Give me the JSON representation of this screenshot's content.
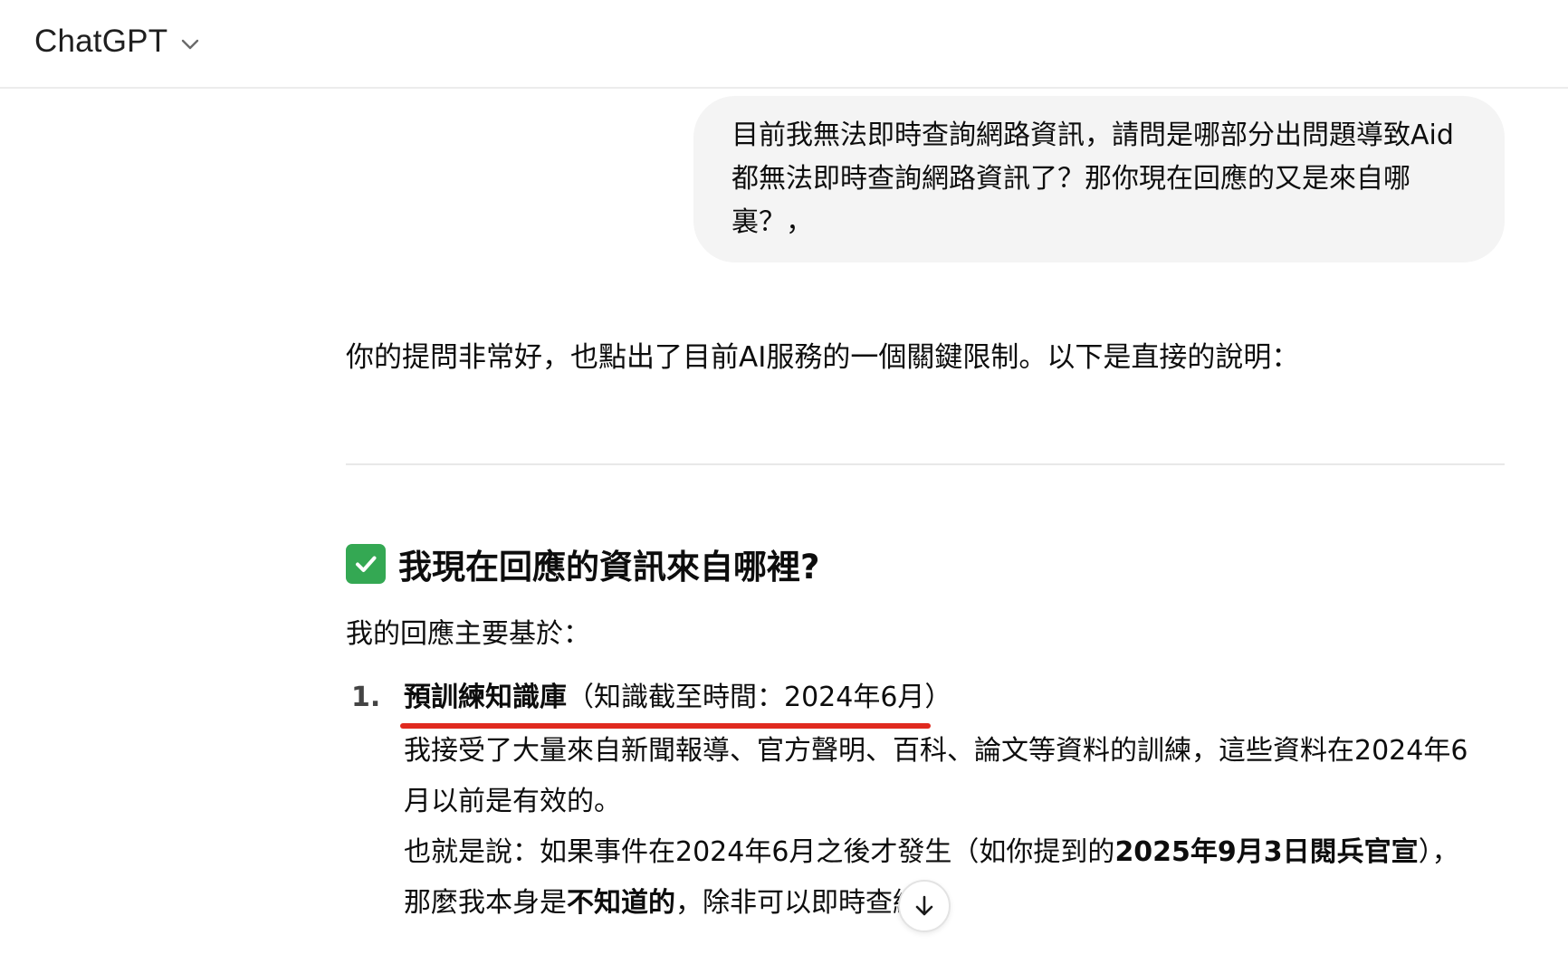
{
  "header": {
    "model_name": "ChatGPT",
    "model_menu_icon": "chevron-down-icon"
  },
  "conversation": {
    "user_message": "目前我無法即時查詢網路資訊，請問是哪部分出問題導致Aid都無法即時查詢網路資訊了？那你現在回應的又是來自哪裏？，",
    "assistant": {
      "intro": "你的提問非常好，也點出了目前AI服務的一個關鍵限制。以下是直接的說明：",
      "section_heading": "我現在回應的資訊來自哪裡?",
      "section_icon": "check-mark-button-icon",
      "lead": "我的回應主要基於：",
      "list": [
        {
          "number": "1.",
          "title": "預訓練知識庫",
          "title_note": "（知識截至時間：2024年6月）",
          "desc_line1": "我接受了大量來自新聞報導、官方聲明、百科、論文等資料的訓練，這些資料在2024年6月以前是有效的。",
          "desc_line2_prefix": "也就是說：如果事件在2024年6月之後才發生（如你提到的",
          "desc_line2_bold": "2025年9月3日閱兵官宣",
          "desc_line2_mid": "），那麼我本身是",
          "desc_line2_bold2": "不知道的",
          "desc_line2_suffix": "，除非可以即時查網。"
        }
      ]
    }
  },
  "controls": {
    "scroll_down_icon": "arrow-down-icon"
  },
  "colors": {
    "user_bubble": "#f4f4f4",
    "underline_annotation": "#e02a1f",
    "check_icon": "#34a853"
  }
}
